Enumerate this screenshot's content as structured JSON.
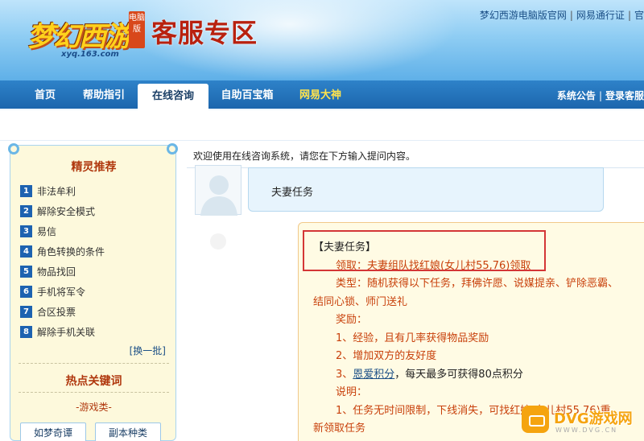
{
  "header": {
    "logo_text": "梦幻西游",
    "logo_sub": "xyq.163.com",
    "logo_tag": "电脑版",
    "zone_title": "客服专区",
    "links": [
      "梦幻西游电脑版官网",
      "网易通行证",
      "官"
    ]
  },
  "nav": {
    "tabs": [
      {
        "label": "首页"
      },
      {
        "label": "帮助指引"
      },
      {
        "label": "在线咨询"
      },
      {
        "label": "自助百宝箱"
      },
      {
        "label": "网易大神"
      }
    ],
    "right": [
      "系统公告",
      "登录客服"
    ]
  },
  "sidebar": {
    "title": "精灵推荐",
    "items": [
      {
        "num": "1",
        "label": "非法牟利"
      },
      {
        "num": "2",
        "label": "解除安全模式"
      },
      {
        "num": "3",
        "label": "易信"
      },
      {
        "num": "4",
        "label": "角色转换的条件"
      },
      {
        "num": "5",
        "label": "物品找回"
      },
      {
        "num": "6",
        "label": "手机将军令"
      },
      {
        "num": "7",
        "label": "合区投票"
      },
      {
        "num": "8",
        "label": "解除手机关联"
      }
    ],
    "more": "[换一批]",
    "hot_title": "热点关键词",
    "category": "-游戏类-",
    "keywords": [
      "如梦奇谭",
      "副本种类"
    ]
  },
  "main": {
    "welcome": "欢迎使用在线咨询系统，请您在下方输入提问内容。",
    "question": "夫妻任务",
    "answer": {
      "title": "【夫妻任务】",
      "line1": "领取：夫妻组队找红娘(女儿村55,76)领取",
      "line2": "类型：随机获得以下任务，拜佛许愿、说媒提亲、铲除恶霸、",
      "line3": "结同心锁、师门送礼",
      "line4": "奖励：",
      "line5": "1、经验，且有几率获得物品奖励",
      "line6": "2、增加双方的友好度",
      "line7_prefix": "3、",
      "line7_link": "恩爱积分",
      "line7_suffix": "，每天最多可获得80点积分",
      "line8": "说明：",
      "line9": "1、任务无时间限制，下线消失，可找红娘(女儿村55,76)重",
      "line10": "新领取任务"
    }
  },
  "watermark": {
    "text": "DVG游戏网",
    "sub": "WWW.DVG.CN"
  }
}
